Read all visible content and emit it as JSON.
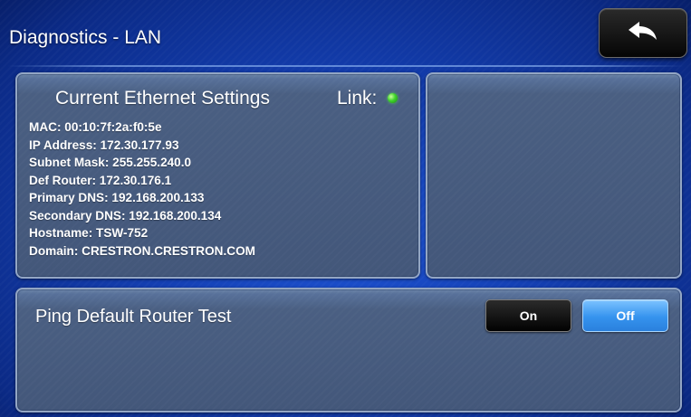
{
  "header": {
    "title": "Diagnostics - LAN",
    "back_icon": "back-arrow-icon"
  },
  "ethernet": {
    "heading": "Current Ethernet Settings",
    "link_label": "Link:",
    "link_status_color": "#3fd42b",
    "items": [
      "MAC: 00:10:7f:2a:f0:5e",
      "IP Address: 172.30.177.93",
      "Subnet Mask: 255.255.240.0",
      "Def Router: 172.30.176.1",
      "Primary DNS: 192.168.200.133",
      "Secondary DNS: 192.168.200.134",
      "Hostname: TSW-752",
      "Domain: CRESTRON.CRESTRON.COM"
    ]
  },
  "ping": {
    "label": "Ping Default Router Test",
    "on_label": "On",
    "off_label": "Off",
    "selected": "Off",
    "active_color": "#3593ee"
  }
}
